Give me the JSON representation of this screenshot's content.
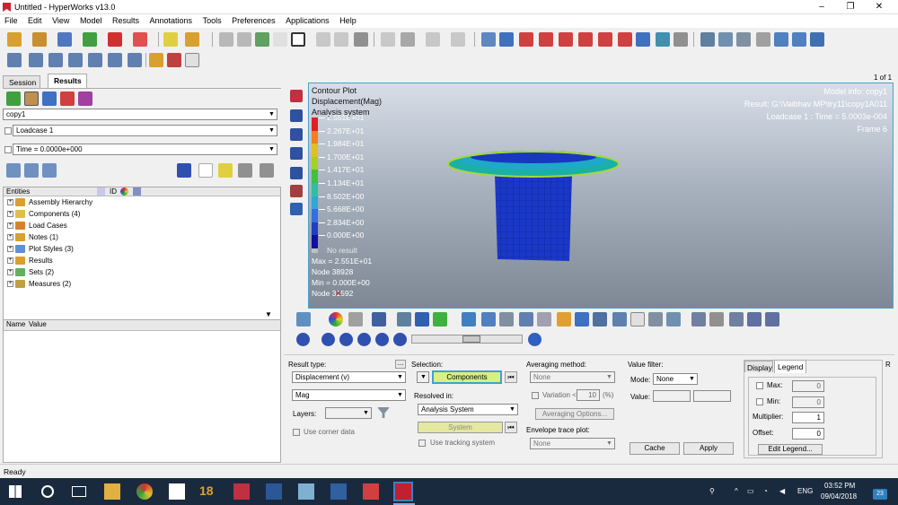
{
  "window": {
    "title": "Untitled - HyperWorks v13.0",
    "minimize": "–",
    "maximize": "❐",
    "close": "✕"
  },
  "menu": [
    "File",
    "Edit",
    "View",
    "Model",
    "Results",
    "Annotations",
    "Tools",
    "Preferences",
    "Applications",
    "Help"
  ],
  "page_indicator": "1 of 1",
  "left_panel": {
    "tabs": [
      "Session",
      "Results"
    ],
    "active_tab": "Results",
    "model_combo": "copy1",
    "loadcase_combo": "Loadcase 1",
    "time_combo": "Time = 0.0000e+000",
    "tree_header": "Entities",
    "tree_id_col": "ID",
    "tree_items": [
      "Assembly Hierarchy",
      "Components (4)",
      "Load Cases",
      "Notes (1)",
      "Plot Styles (3)",
      "Results",
      "Sets  (2)",
      "Measures (2)"
    ],
    "props_name": "Name",
    "props_value": "Value"
  },
  "viewport": {
    "contour_lines": [
      "Contour Plot",
      "Displacement(Mag)",
      "Analysis system"
    ],
    "legend_values": [
      "2.551E+01",
      "2.267E+01",
      "1.984E+01",
      "1.700E+01",
      "1.417E+01",
      "1.134E+01",
      "8.502E+00",
      "5.668E+00",
      "2.834E+00",
      "0.000E+00"
    ],
    "legend_colors": [
      "#e02020",
      "#f08020",
      "#e0c020",
      "#a8d020",
      "#40c040",
      "#30c0a0",
      "#30a8d8",
      "#3070e0",
      "#2040c0",
      "#1010a0"
    ],
    "no_result": "No result",
    "max_line": "Max = 2.551E+01",
    "max_node": "Node 38928",
    "min_line": "Min = 0.000E+00",
    "min_node": "Node 31592",
    "model_info": [
      "Model info: copy1",
      "Result: G:\\Vaibhav MP\\try11\\copy1A011",
      "Loadcase 1 : Time = 5.0003e-004",
      "Frame 6"
    ]
  },
  "controls": {
    "result_type_label": "Result type:",
    "result_type": "Displacement (v)",
    "component": "Mag",
    "layers_label": "Layers:",
    "use_corner_data": "Use corner data",
    "selection_label": "Selection:",
    "selection_button": "Components",
    "resolved_in_label": "Resolved in:",
    "resolved_in": "Analysis System",
    "system_button": "System",
    "use_tracking": "Use tracking system",
    "averaging_label": "Averaging method:",
    "averaging_value": "None",
    "variation_label": "Variation <",
    "variation_value": "10",
    "variation_unit": "(%)",
    "averaging_options": "Averaging Options...",
    "envelope_label": "Envelope trace plot:",
    "envelope_value": "None",
    "value_filter_label": "Value filter:",
    "mode_label": "Mode:",
    "mode_value": "None",
    "value_label": "Value:",
    "cache_button": "Cache",
    "apply_button": "Apply",
    "display_tab": "Display",
    "legend_tab": "Legend",
    "max_label": "Max:",
    "max_value": "0",
    "min_label": "Min:",
    "min_value": "0",
    "multiplier_label": "Multiplier:",
    "multiplier_value": "1",
    "offset_label": "Offset:",
    "offset_value": "0",
    "edit_legend": "Edit Legend...",
    "r_tab": "R"
  },
  "status": "Ready",
  "taskbar": {
    "time": "03:52 PM",
    "date": "09/04/2018",
    "lang": "ENG",
    "badge": "23",
    "app_18": "18"
  }
}
